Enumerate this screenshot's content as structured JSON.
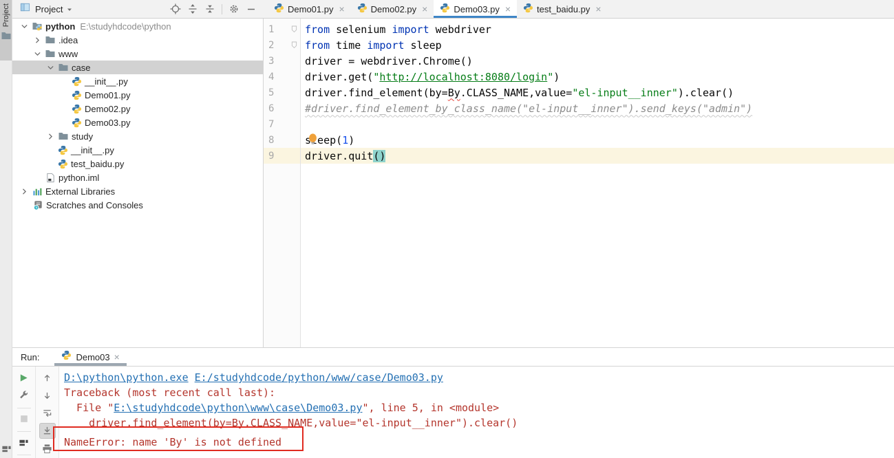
{
  "stripe": {
    "label": "Project"
  },
  "project": {
    "header": {
      "title": "Project",
      "actions": [
        "locate",
        "expand-all",
        "collapse-all",
        "sep",
        "gear",
        "minimize"
      ]
    },
    "tree": [
      {
        "label": "python",
        "path": "E:\\studyhdcode\\python",
        "icon": "python-root",
        "chevron": "down",
        "indent": 8,
        "bold": true
      },
      {
        "label": ".idea",
        "icon": "folder",
        "chevron": "right",
        "indent": 27
      },
      {
        "label": "www",
        "icon": "folder",
        "chevron": "down",
        "indent": 27
      },
      {
        "label": "case",
        "icon": "folder",
        "chevron": "down",
        "indent": 46,
        "selected": true
      },
      {
        "label": "__init__.py",
        "icon": "python-file",
        "chevron": "none",
        "indent": 83
      },
      {
        "label": "Demo01.py",
        "icon": "python-file",
        "chevron": "none",
        "indent": 83
      },
      {
        "label": "Demo02.py",
        "icon": "python-file",
        "chevron": "none",
        "indent": 83
      },
      {
        "label": "Demo03.py",
        "icon": "python-file",
        "chevron": "none",
        "indent": 83
      },
      {
        "label": "study",
        "icon": "folder",
        "chevron": "right",
        "indent": 46
      },
      {
        "label": "__init__.py",
        "icon": "python-file",
        "chevron": "none",
        "indent": 63
      },
      {
        "label": "test_baidu.py",
        "icon": "python-file",
        "chevron": "none",
        "indent": 63
      },
      {
        "label": "python.iml",
        "icon": "iml-file",
        "chevron": "none",
        "indent": 45
      },
      {
        "label": "External Libraries",
        "icon": "libraries",
        "chevron": "right",
        "indent": 8
      },
      {
        "label": "Scratches and Consoles",
        "icon": "scratches",
        "chevron": "none",
        "indent": 27
      }
    ]
  },
  "editor": {
    "tabs": [
      {
        "label": "Demo01.py",
        "active": false
      },
      {
        "label": "Demo02.py",
        "active": false
      },
      {
        "label": "Demo03.py",
        "active": true
      },
      {
        "label": "test_baidu.py",
        "active": false
      }
    ],
    "lines": [
      {
        "n": 1,
        "fold": true,
        "segs": [
          [
            "k",
            "from"
          ],
          [
            "p",
            " selenium "
          ],
          [
            "k",
            "import"
          ],
          [
            "p",
            " webdriver"
          ]
        ]
      },
      {
        "n": 2,
        "fold": true,
        "segs": [
          [
            "k",
            "from"
          ],
          [
            "p",
            " time "
          ],
          [
            "k",
            "import"
          ],
          [
            "p",
            " sleep"
          ]
        ]
      },
      {
        "n": 3,
        "segs": [
          [
            "p",
            "driver = webdriver.Chrome()"
          ]
        ]
      },
      {
        "n": 4,
        "segs": [
          [
            "p",
            "driver.get("
          ],
          [
            "s",
            "\""
          ],
          [
            "sl",
            "http://localhost:8080/login"
          ],
          [
            "s",
            "\""
          ],
          [
            "p",
            ")"
          ]
        ]
      },
      {
        "n": 5,
        "segs": [
          [
            "p",
            "driver.find_element(by="
          ],
          [
            "eb",
            "By"
          ],
          [
            "p",
            ".CLASS_NAME,value="
          ],
          [
            "s",
            "\"el-input__inner\""
          ],
          [
            "p",
            ").clear()"
          ]
        ]
      },
      {
        "n": 6,
        "segs": [
          [
            "c",
            "#driver.find_element_by_class_name(\"el-input__inner\").send_keys(\"admin\")"
          ]
        ]
      },
      {
        "n": 7,
        "segs": []
      },
      {
        "n": 8,
        "bulb": true,
        "segs": [
          [
            "p",
            "sleep("
          ],
          [
            "n",
            "1"
          ],
          [
            "p",
            ")"
          ]
        ]
      },
      {
        "n": 9,
        "caret": true,
        "segs": [
          [
            "p",
            "driver.quit"
          ],
          [
            "bh",
            "("
          ],
          [
            "bh",
            ")"
          ]
        ]
      }
    ]
  },
  "run": {
    "label": "Run:",
    "tab": {
      "label": "Demo03"
    },
    "toolbar_main": [
      "play",
      "wrench",
      "sep",
      "stop",
      "sep",
      "layout",
      "sep"
    ],
    "toolbar_console": [
      "arrow-up",
      "arrow-down",
      "rerun",
      "scroll-end",
      "printer"
    ],
    "console_selected_action": "scroll-end",
    "console": {
      "lines": [
        {
          "segs": [
            [
              "lnk",
              "D:\\python\\python.exe"
            ],
            [
              "err",
              " "
            ],
            [
              "lnk",
              "E:/studyhdcode/python/www/case/Demo03.py"
            ]
          ]
        },
        {
          "segs": [
            [
              "err",
              "Traceback (most recent call last):"
            ]
          ]
        },
        {
          "segs": [
            [
              "err",
              "  File \""
            ],
            [
              "lnk",
              "E:\\studyhdcode\\python\\www\\case\\Demo03.py"
            ],
            [
              "err",
              "\", line 5, in <module>"
            ]
          ]
        },
        {
          "segs": [
            [
              "err",
              "    driver.find_element(by=By.CLASS_NAME,value=\"el-input__inner\").clear()"
            ]
          ]
        },
        {
          "boxed": true,
          "segs": [
            [
              "err",
              "NameError: name 'By' is not defined"
            ]
          ]
        }
      ]
    },
    "error_box": {
      "color": "#E02B20"
    }
  },
  "colors": {
    "tab_accent": "#3E86C7",
    "tree_selection": "#D2D2D2",
    "caret_row": "#FBF5E0",
    "brace_match": "#8FD3CC",
    "keyword": "#0033B3",
    "string": "#067D17",
    "number": "#1750EB",
    "comment": "#8C8C8C",
    "stderr": "#B4352C",
    "link": "#2470B3",
    "run_tab_underline": "#9DA7B1"
  }
}
